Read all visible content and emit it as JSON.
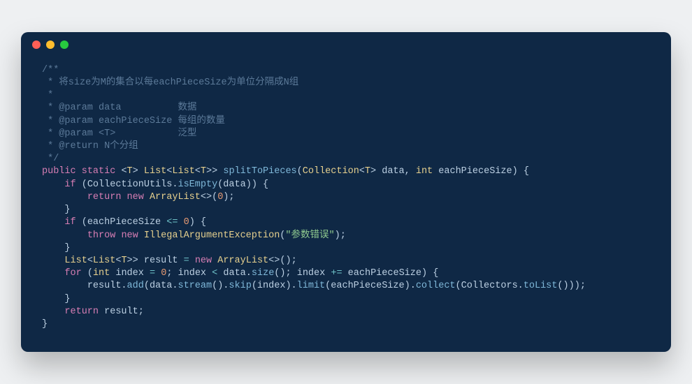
{
  "window": {
    "dots": [
      "red",
      "yellow",
      "green"
    ]
  },
  "code": {
    "comment": {
      "open": "/**",
      "l1": " * 将size为M的集合以每eachPieceSize为单位分隔成N组",
      "l2": " *",
      "l3a": " * @param data          ",
      "l3b": "数据",
      "l4a": " * @param eachPieceSize ",
      "l4b": "每组的数量",
      "l5a": " * @param <T>           ",
      "l5b": "泛型",
      "l6a": " * @return ",
      "l6b": "N个分组",
      "close": " */"
    },
    "sig": {
      "indent1": "    ",
      "indent2": "        ",
      "indent3": "            ",
      "kw_public": "public",
      "kw_static": "static",
      "kw_if": "if",
      "kw_return": "return",
      "kw_new": "new",
      "kw_throw": "throw",
      "kw_for": "for",
      "type_T": "T",
      "type_List": "List",
      "type_Collection": "Collection",
      "type_ArrayList": "ArrayList",
      "type_IAE": "IllegalArgumentException",
      "type_int": "int",
      "type_Collectors": "Collectors",
      "m_split": "splitToPieces",
      "m_isEmpty": "isEmpty",
      "m_size": "size",
      "m_add": "add",
      "m_stream": "stream",
      "m_skip": "skip",
      "m_limit": "limit",
      "m_collect": "collect",
      "m_toList": "toList",
      "v_data": "data",
      "v_epz": "eachPieceSize",
      "v_CU": "CollectionUtils",
      "v_result": "result",
      "v_index": "index",
      "n_0": "0",
      "str_err": "\"参数错误\"",
      "p_lt": "<",
      "p_gt": ">",
      "p_ltgt": "<>",
      "p_op": "(",
      "p_cp": ")",
      "p_ob": "{",
      "p_cb": "}",
      "p_c": ",",
      "p_sc": ";",
      "p_dot": ".",
      "p_sp": " ",
      "op_le": "<=",
      "op_lt": "<",
      "op_eq": "=",
      "op_pe": "+="
    }
  }
}
